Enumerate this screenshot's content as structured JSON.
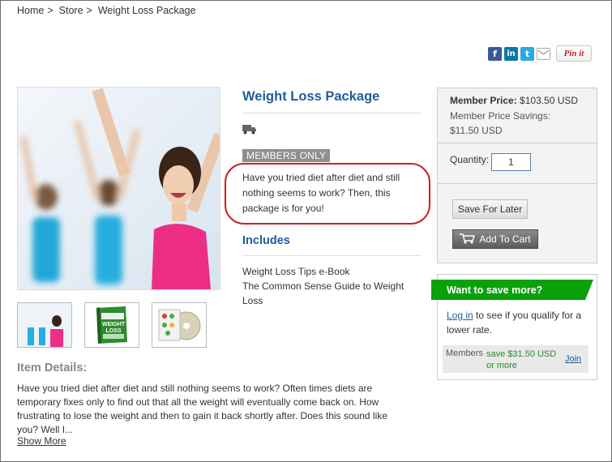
{
  "breadcrumb": {
    "items": [
      "Home",
      "Store",
      "Weight Loss Package"
    ],
    "separator": ">"
  },
  "social": {
    "icons": [
      "facebook-icon",
      "linkedin-icon",
      "twitter-icon",
      "email-icon"
    ],
    "pin_label": "Pin it",
    "colors": {
      "facebook": "#3b5998",
      "linkedin": "#0e76a8",
      "twitter": "#2aa9e0",
      "pinterest": "#c8232c"
    }
  },
  "product": {
    "title": "Weight Loss Package",
    "badge": "MEMBERS ONLY",
    "short_description": "Have you tried diet after diet and still nothing seems to work? Then, this package is for you!",
    "includes_heading": "Includes",
    "includes": [
      "Weight Loss Tips e-Book",
      "The Common Sense Guide to Weight Loss"
    ],
    "item_details_heading": "Item Details:",
    "item_details": "Have you tried diet after diet and still nothing seems to work?  Often times diets are temporary fixes only to find out that all the weight will eventually come back on.  How frustrating to lose the weight and then to gain it back shortly after.  Does this sound like you?  Well I...",
    "show_more": "Show More",
    "thumb_book_text": "WEIGHT LOSS"
  },
  "pricing": {
    "member_price_label": "Member Price:",
    "member_price_value": "$103.50 USD",
    "savings_label": "Member Price Savings:",
    "savings_value": "$11.50 USD",
    "quantity_label": "Quantity:",
    "quantity_value": "1",
    "save_for_later": "Save For Later",
    "add_to_cart": "Add To Cart"
  },
  "save_more": {
    "heading": "Want to save more?",
    "login_link": "Log in",
    "login_rest": " to see if you qualify for a lower rate.",
    "members_label": "Members",
    "members_savings": "save $31.50 USD or more",
    "join_link": "Join"
  },
  "accent_colors": {
    "title_blue": "#1f5d9c",
    "green": "#0ba10b",
    "highlight_red": "#d11d24"
  }
}
